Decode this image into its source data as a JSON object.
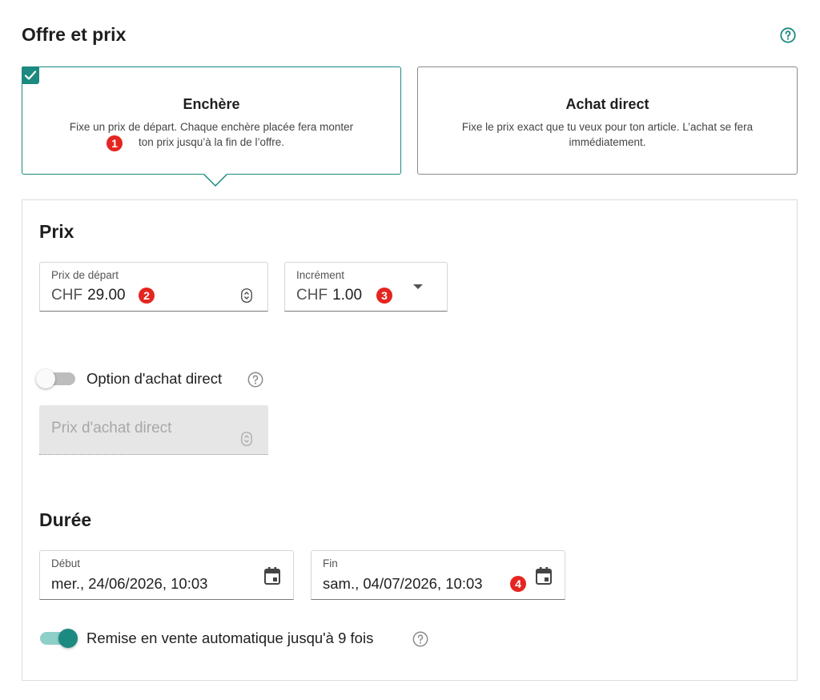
{
  "header": {
    "title": "Offre et prix",
    "help_icon": "help-circle-icon"
  },
  "offer_types": [
    {
      "title": "Enchère",
      "description_line1": "Fixe un prix de départ. Chaque enchère placée fera monter",
      "description_line2": "ton prix jusqu’à la fin de l’offre.",
      "selected": true,
      "annotation": "1"
    },
    {
      "title": "Achat direct",
      "description_line1": "Fixe le prix exact que tu veux pour ton article. L’achat se fera",
      "description_line2": "immédiatement.",
      "selected": false
    }
  ],
  "price": {
    "section_title": "Prix",
    "start_price": {
      "label": "Prix de départ",
      "currency": "CHF",
      "value": "29.00",
      "annotation": "2"
    },
    "increment": {
      "label": "Incrément",
      "currency": "CHF",
      "value": "1.00",
      "annotation": "3"
    },
    "buy_now_option": {
      "label": "Option d'achat direct",
      "enabled": false
    },
    "buy_now_price": {
      "placeholder": "Prix d'achat direct"
    }
  },
  "duration": {
    "section_title": "Durée",
    "start": {
      "label": "Début",
      "value": "mer., 24/06/2026, 10:03"
    },
    "end": {
      "label": "Fin",
      "value": "sam., 04/07/2026, 10:03",
      "annotation": "4"
    },
    "relist": {
      "label": "Remise en vente automatique jusqu'à 9 fois",
      "enabled": true
    }
  },
  "colors": {
    "accent": "#1c8a80",
    "annotation": "#e52520",
    "toggle_on_track": "#8fcfc9",
    "toggle_off_track": "#bdbdbd"
  }
}
